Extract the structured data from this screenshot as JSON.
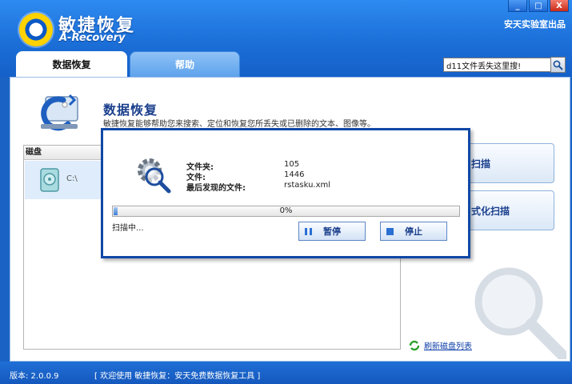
{
  "header": {
    "title": "敏捷恢复",
    "subtitle": "A-Recovery",
    "brand": "安天实验室出品",
    "window_buttons": [
      "_",
      "□",
      "X"
    ]
  },
  "tabs": [
    {
      "label": "数据恢复",
      "active": true
    },
    {
      "label": "帮助",
      "active": false
    }
  ],
  "search": {
    "value": "d11文件丢失这里搜!"
  },
  "main": {
    "title": "数据恢复",
    "description": "敏捷恢复能够帮助您来搜索、定位和恢复您所丢失或已删除的文本、图像等。",
    "disk_header": "磁盘",
    "disks": [
      {
        "label": "C:\\"
      }
    ],
    "scan_label": "扫描",
    "format_scan_label": "式化扫描",
    "refresh_label": "刷新磁盘列表"
  },
  "dialog": {
    "folder_label": "文件夹:",
    "folder_value": "105",
    "file_label": "文件:",
    "file_value": "1446",
    "last_label": "最后发现的文件:",
    "last_value": "rstasku.xml",
    "progress_percent": 0,
    "progress_text": "0%",
    "status_text": "扫描中...",
    "pause_label": "暂停",
    "stop_label": "停止"
  },
  "status": {
    "version": "版本: 2.0.0.9",
    "message": "[ 欢迎使用 敏捷恢复：安天免费数据恢复工具 ]"
  },
  "colors": {
    "accent": "#1c6fd8",
    "dialog_border": "#1048a6",
    "title": "#1a3f8c"
  }
}
